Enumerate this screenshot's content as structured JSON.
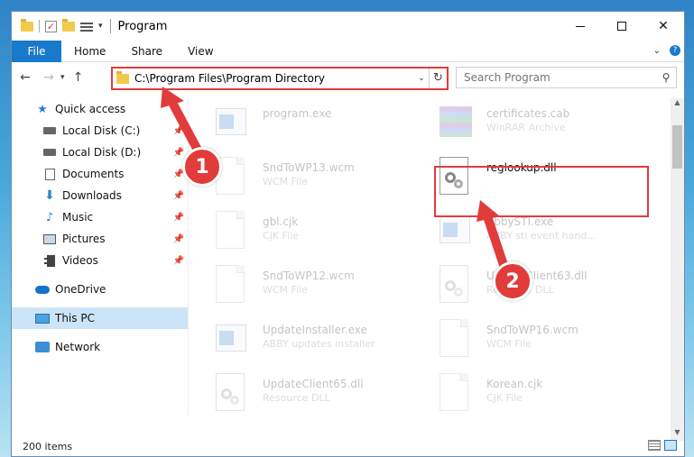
{
  "window": {
    "title": "Program"
  },
  "ribbon": {
    "file": "File",
    "home": "Home",
    "share": "Share",
    "view": "View"
  },
  "address": {
    "path": "C:\\Program Files\\Program Directory"
  },
  "search": {
    "placeholder": "Search Program"
  },
  "sidebar": {
    "items": [
      {
        "label": "Quick access",
        "icon": "star-icon"
      },
      {
        "label": "Local Disk (C:)",
        "icon": "drive-icon",
        "pinned": true
      },
      {
        "label": "Local Disk (D:)",
        "icon": "drive-icon",
        "pinned": true
      },
      {
        "label": "Documents",
        "icon": "documents-icon",
        "pinned": true
      },
      {
        "label": "Downloads",
        "icon": "downloads-icon",
        "pinned": true
      },
      {
        "label": "Music",
        "icon": "music-icon",
        "pinned": true
      },
      {
        "label": "Pictures",
        "icon": "pictures-icon",
        "pinned": true
      },
      {
        "label": "Videos",
        "icon": "videos-icon",
        "pinned": true
      },
      {
        "label": "OneDrive",
        "icon": "onedrive-icon"
      },
      {
        "label": "This PC",
        "icon": "this-pc-icon",
        "selected": true
      },
      {
        "label": "Network",
        "icon": "network-icon"
      }
    ]
  },
  "files": [
    {
      "name": "program.exe",
      "type": "",
      "icon": "exe-icon",
      "faded": true
    },
    {
      "name": "certificates.cab",
      "type": "WinRAR Archive",
      "icon": "cab-icon",
      "faded": true
    },
    {
      "name": "SndToWP13.wcm",
      "type": "WCM File",
      "icon": "doc-icon",
      "faded": true
    },
    {
      "name": "reglookup.dll",
      "type": "",
      "icon": "dll-gear-icon",
      "faded": false,
      "highlighted": true
    },
    {
      "name": "gbl.cjk",
      "type": "CJK File",
      "icon": "doc-icon",
      "faded": true
    },
    {
      "name": "AbbySTI.exe",
      "type": "ABBY sti event hand...",
      "icon": "exe-icon",
      "faded": true
    },
    {
      "name": "SndToWP12.wcm",
      "type": "WCM File",
      "icon": "doc-icon",
      "faded": true
    },
    {
      "name": "UpdateClient63.dll",
      "type": "Resource DLL",
      "icon": "dll-gear-icon",
      "faded": true
    },
    {
      "name": "UpdateInstaller.exe",
      "type": "ABBY updates installer",
      "icon": "exe-icon",
      "faded": true
    },
    {
      "name": "SndToWP16.wcm",
      "type": "WCM File",
      "icon": "doc-icon",
      "faded": true
    },
    {
      "name": "UpdateClient65.dll",
      "type": "Resource DLL",
      "icon": "dll-gear-icon",
      "faded": true
    },
    {
      "name": "Korean.cjk",
      "type": "CJK File",
      "icon": "doc-icon",
      "faded": true
    }
  ],
  "status": {
    "count": "200 items"
  },
  "annotations": {
    "step1": "1",
    "step2": "2",
    "color": "#e23b3b"
  }
}
